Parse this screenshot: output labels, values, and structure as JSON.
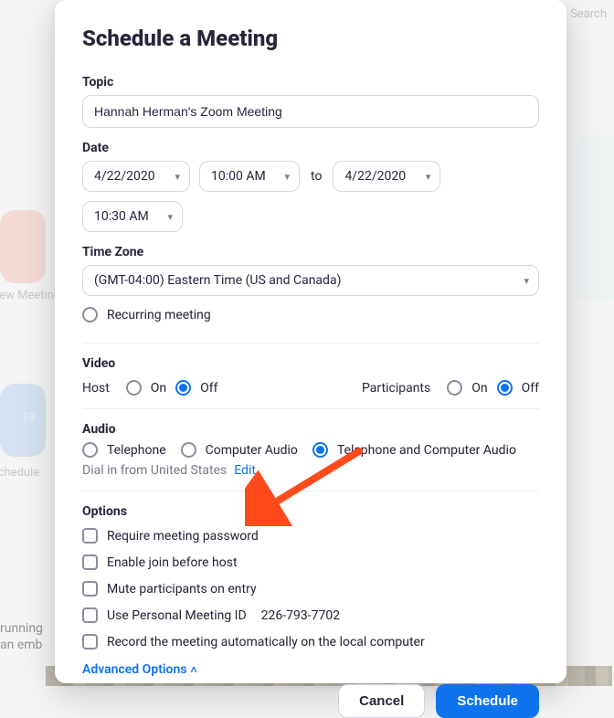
{
  "title": "Schedule a Meeting",
  "topic": {
    "label": "Topic",
    "value": "Hannah Herman's Zoom Meeting"
  },
  "date": {
    "label": "Date",
    "start_date": "4/22/2020",
    "start_time": "10:00 AM",
    "to": "to",
    "end_date": "4/22/2020",
    "end_time": "10:30 AM"
  },
  "timezone": {
    "label": "Time Zone",
    "value": "(GMT-04:00) Eastern Time (US and Canada)"
  },
  "recurring": {
    "label": "Recurring meeting",
    "checked": false
  },
  "video": {
    "label": "Video",
    "host": {
      "label": "Host",
      "on": "On",
      "off": "Off",
      "selected": "off"
    },
    "participants": {
      "label": "Participants",
      "on": "On",
      "off": "Off",
      "selected": "off"
    }
  },
  "audio": {
    "label": "Audio",
    "telephone": "Telephone",
    "computer": "Computer Audio",
    "both": "Telephone and Computer Audio",
    "selected": "both",
    "dial_in_text": "Dial in from United States",
    "edit": "Edit"
  },
  "options": {
    "label": "Options",
    "items": [
      {
        "label": "Require meeting password",
        "checked": false
      },
      {
        "label": "Enable join before host",
        "checked": false
      },
      {
        "label": "Mute participants on entry",
        "checked": false
      },
      {
        "label": "Use Personal Meeting ID",
        "suffix": "226-793-7702",
        "checked": false
      },
      {
        "label": "Record the meeting automatically on the local computer",
        "checked": false
      }
    ],
    "advanced": "Advanced Options"
  },
  "buttons": {
    "cancel": "Cancel",
    "schedule": "Schedule"
  },
  "bg": {
    "search_placeholder": "Search",
    "new_meeting": "New Meeting",
    "schedule_label": "Schedule",
    "calendar_day": "19",
    "running": "running",
    "emb": "an emb"
  }
}
